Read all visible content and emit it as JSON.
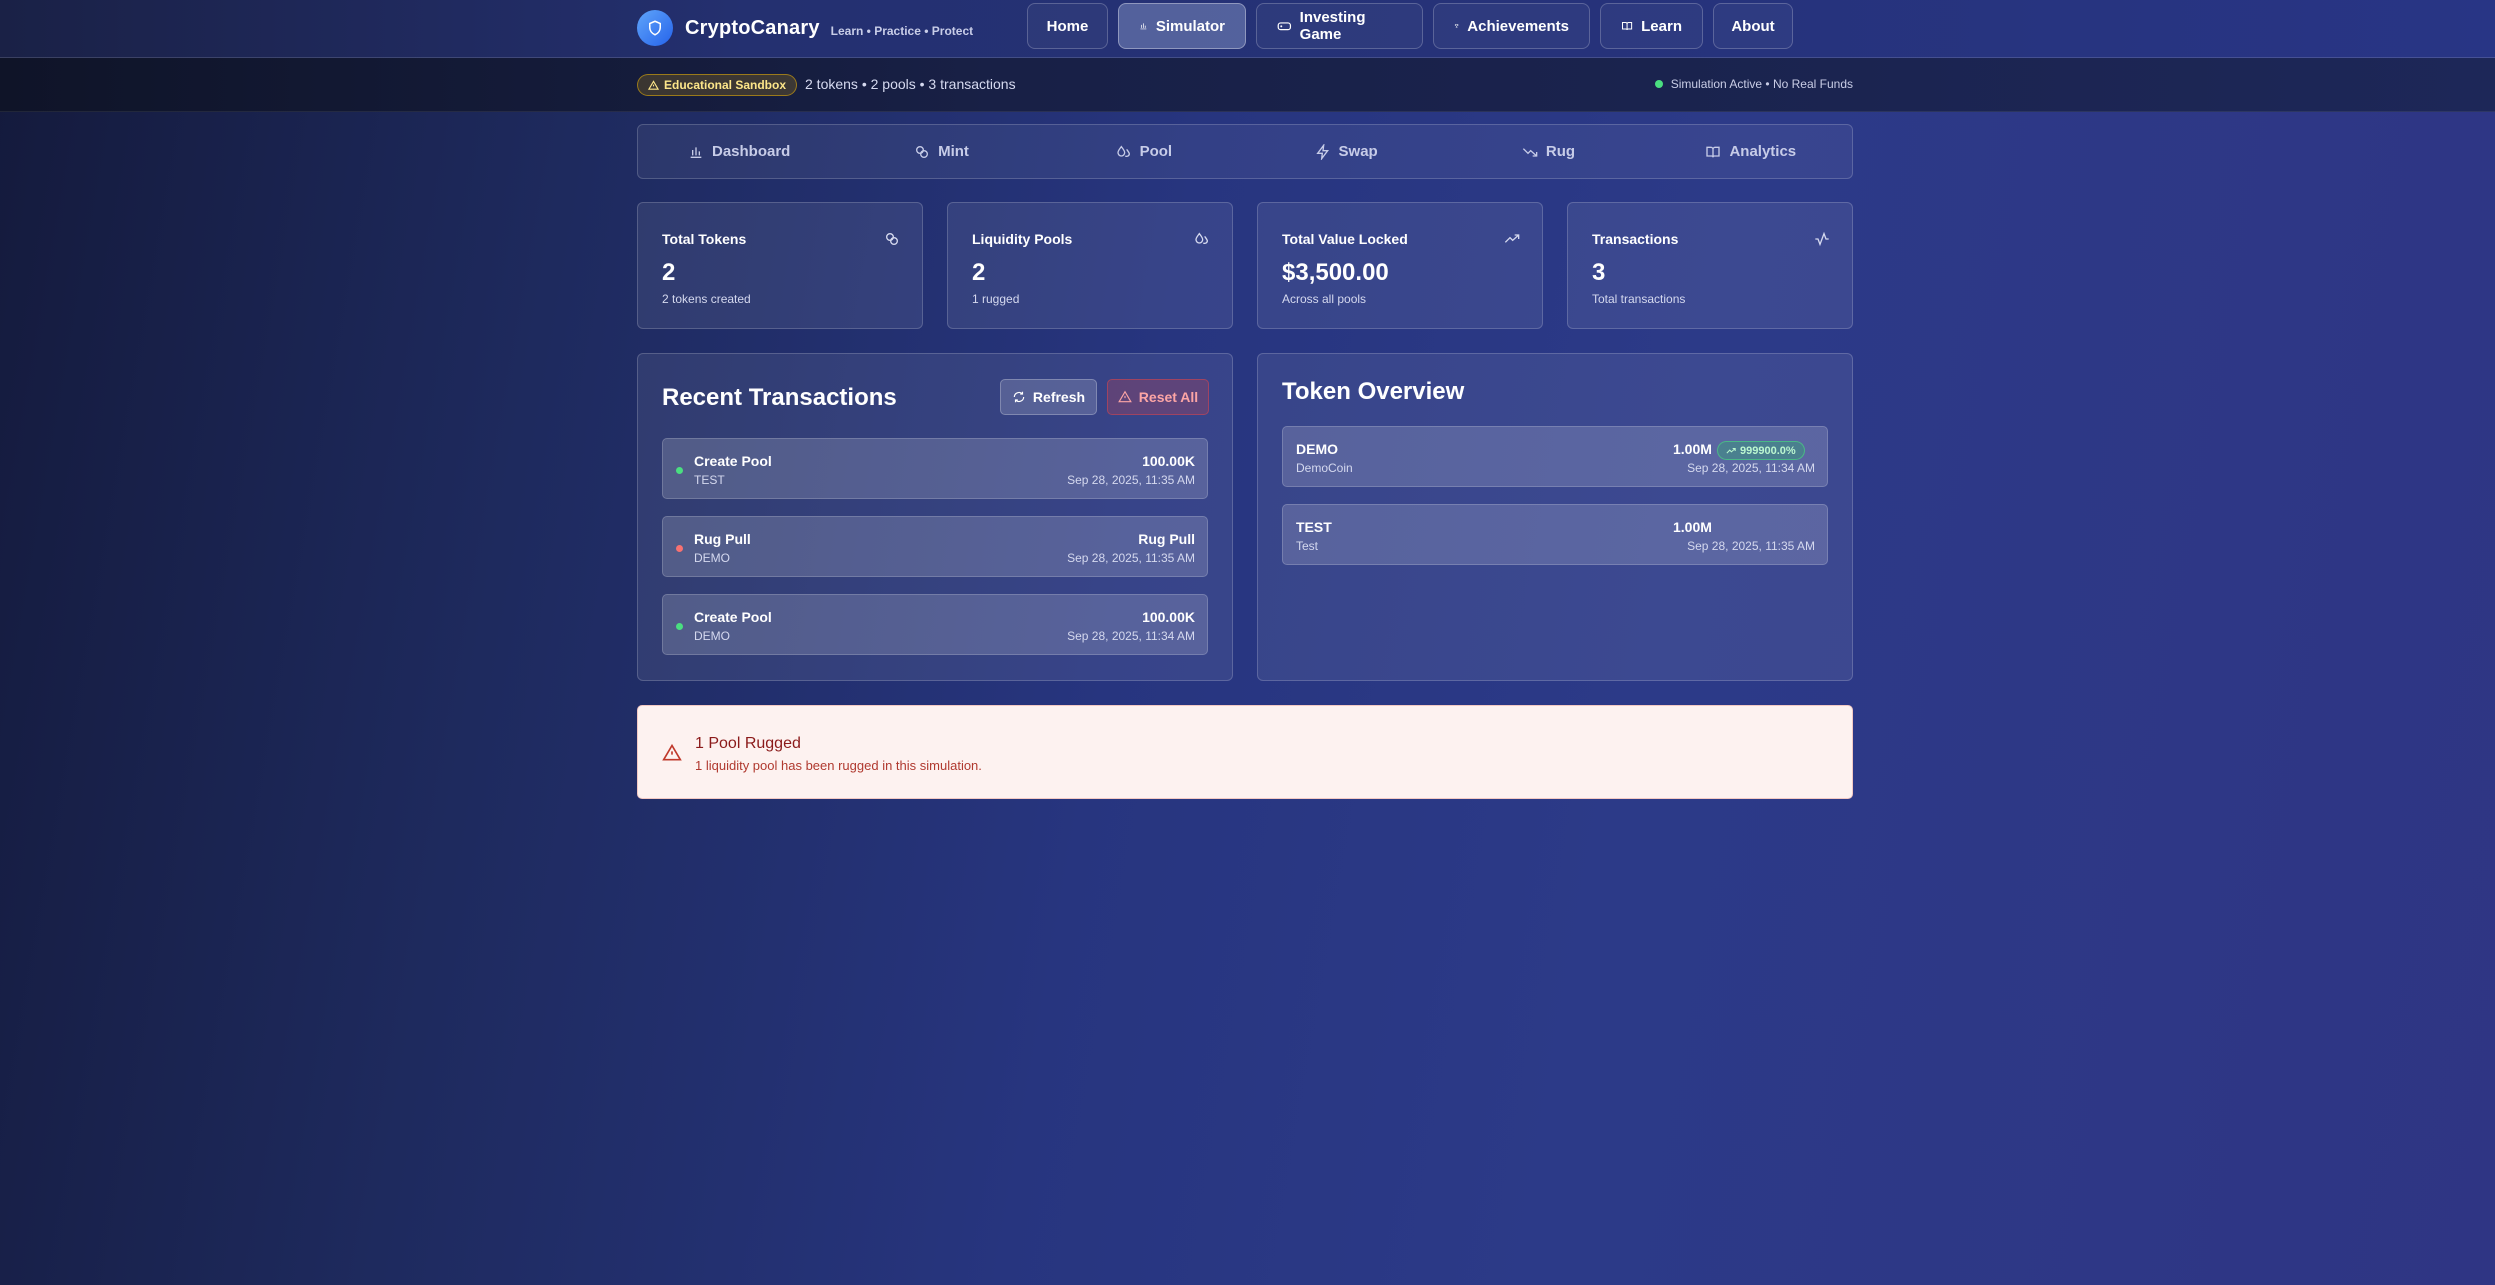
{
  "brand": {
    "name": "CryptoCanary",
    "tagline": "Learn • Practice • Protect",
    "logo_icon": "shield-icon"
  },
  "nav": [
    {
      "label": "Home",
      "icon": "",
      "active": false
    },
    {
      "label": "Simulator",
      "icon": "bar-chart-icon",
      "active": true
    },
    {
      "label": "Investing Game",
      "icon": "gamepad-icon",
      "active": false
    },
    {
      "label": "Achievements",
      "icon": "trophy-icon",
      "active": false
    },
    {
      "label": "Learn",
      "icon": "book-icon",
      "active": false
    },
    {
      "label": "About",
      "icon": "",
      "active": false
    }
  ],
  "status": {
    "badge": "Educational Sandbox",
    "summary": "2 tokens • 2 pools • 3 transactions",
    "simulation": "Simulation Active • No Real Funds"
  },
  "tabs": [
    {
      "label": "Dashboard",
      "icon": "bar-chart-icon"
    },
    {
      "label": "Mint",
      "icon": "coins-icon"
    },
    {
      "label": "Pool",
      "icon": "droplets-icon"
    },
    {
      "label": "Swap",
      "icon": "zap-icon"
    },
    {
      "label": "Rug",
      "icon": "trending-down-icon"
    },
    {
      "label": "Analytics",
      "icon": "book-open-icon"
    }
  ],
  "stats": [
    {
      "label": "Total Tokens",
      "value": "2",
      "sub": "2 tokens created",
      "icon": "coins-icon"
    },
    {
      "label": "Liquidity Pools",
      "value": "2",
      "sub": "1 rugged",
      "icon": "droplets-icon"
    },
    {
      "label": "Total Value Locked",
      "value": "$3,500.00",
      "sub": "Across all pools",
      "icon": "trending-up-icon"
    },
    {
      "label": "Transactions",
      "value": "3",
      "sub": "Total transactions",
      "icon": "activity-icon"
    }
  ],
  "transactions": {
    "title": "Recent Transactions",
    "refresh_label": "Refresh",
    "reset_label": "Reset All",
    "items": [
      {
        "type": "Create Pool",
        "token": "TEST",
        "amount": "100.00K",
        "date": "Sep 28, 2025, 11:35 AM",
        "status_color": "#4ade80"
      },
      {
        "type": "Rug Pull",
        "token": "DEMO",
        "amount": "Rug Pull",
        "date": "Sep 28, 2025, 11:35 AM",
        "status_color": "#f87171"
      },
      {
        "type": "Create Pool",
        "token": "DEMO",
        "amount": "100.00K",
        "date": "Sep 28, 2025, 11:34 AM",
        "status_color": "#4ade80"
      }
    ]
  },
  "tokens": {
    "title": "Token Overview",
    "items": [
      {
        "symbol": "DEMO",
        "name": "DemoCoin",
        "supply": "1.00M",
        "change": "999900.0%",
        "date": "Sep 28, 2025, 11:34 AM"
      },
      {
        "symbol": "TEST",
        "name": "Test",
        "supply": "1.00M",
        "change": "",
        "date": "Sep 28, 2025, 11:35 AM"
      }
    ]
  },
  "alert": {
    "title": "1 Pool Rugged",
    "text": "1 liquidity pool has been rugged in this simulation."
  },
  "colors": {
    "accent": "#3b82f6",
    "danger": "#ef4444",
    "success": "#4ade80",
    "warning": "#eab308"
  }
}
